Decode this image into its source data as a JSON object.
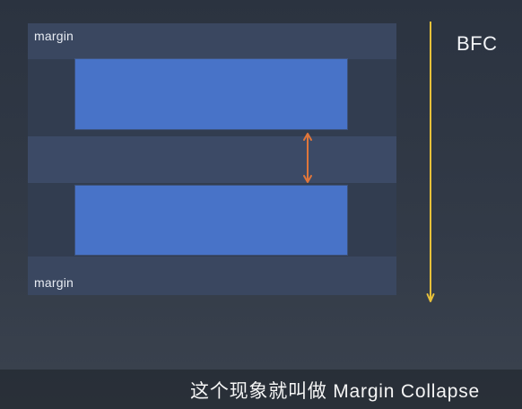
{
  "diagram": {
    "margin_top_label": "margin",
    "margin_bottom_label": "margin",
    "context_label": "BFC"
  },
  "colors": {
    "background": "#2f3744",
    "container": "#323d50",
    "margin_band": "#3a4760",
    "block": "#4873c8",
    "collapse_arrow": "#e0763a",
    "bfc_axis": "#e8c13a",
    "text": "#e8ecf3"
  },
  "subtitle": {
    "text": "这个现象就叫做 Margin Collapse"
  }
}
